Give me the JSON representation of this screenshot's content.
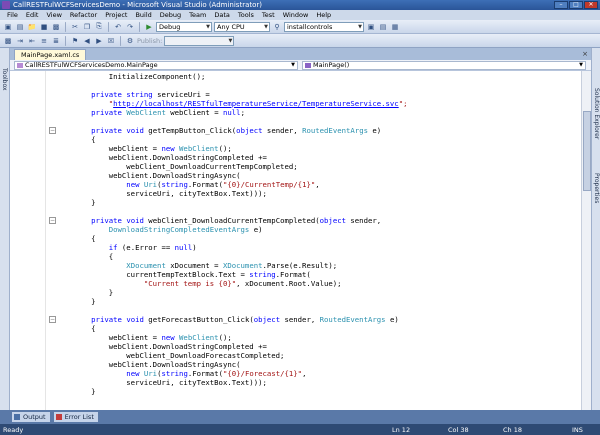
{
  "window": {
    "title": "CallRESTFulWCFServicesDemo - Microsoft Visual Studio (Administrator)"
  },
  "menu": [
    "File",
    "Edit",
    "View",
    "Refactor",
    "Project",
    "Build",
    "Debug",
    "Team",
    "Data",
    "Tools",
    "Test",
    "Window",
    "Help"
  ],
  "toolbar": {
    "config": "Debug",
    "platform": "Any CPU",
    "find_value": "installcontrols",
    "publish_label": "Publish:"
  },
  "tabs": {
    "active_label": "MainPage.xaml.cs"
  },
  "navbar": {
    "class_combo": "CallRESTFulWCFServicesDemo.MainPage",
    "member_combo": "MainPage()"
  },
  "side": {
    "left_label": "Toolbox",
    "right_labels": [
      "Solution Explorer",
      "Properties"
    ]
  },
  "code_lines": [
    [
      {
        "t": "            InitializeComponent();"
      }
    ],
    [],
    [
      {
        "t": "        "
      },
      {
        "t": "private",
        "c": "kw"
      },
      {
        "t": " "
      },
      {
        "t": "string",
        "c": "kw"
      },
      {
        "t": " serviceUri ="
      }
    ],
    [
      {
        "t": "            "
      },
      {
        "t": "\"",
        "c": "st"
      },
      {
        "t": "http://localhost/RESTfulTemperatureService/TemperatureService.svc",
        "c": "ul"
      },
      {
        "t": "\";",
        "c": "st"
      }
    ],
    [
      {
        "t": "        "
      },
      {
        "t": "private",
        "c": "kw"
      },
      {
        "t": " "
      },
      {
        "t": "WebClient",
        "c": "ty"
      },
      {
        "t": " webClient = "
      },
      {
        "t": "null",
        "c": "kw"
      },
      {
        "t": ";"
      }
    ],
    [],
    [
      {
        "t": "        "
      },
      {
        "t": "private",
        "c": "kw"
      },
      {
        "t": " "
      },
      {
        "t": "void",
        "c": "kw"
      },
      {
        "t": " getTempButton_Click("
      },
      {
        "t": "object",
        "c": "kw"
      },
      {
        "t": " sender, "
      },
      {
        "t": "RoutedEventArgs",
        "c": "ty"
      },
      {
        "t": " e)"
      }
    ],
    [
      {
        "t": "        {"
      }
    ],
    [
      {
        "t": "            webClient = "
      },
      {
        "t": "new",
        "c": "kw"
      },
      {
        "t": " "
      },
      {
        "t": "WebClient",
        "c": "ty"
      },
      {
        "t": "();"
      }
    ],
    [
      {
        "t": "            webClient.DownloadStringCompleted +="
      }
    ],
    [
      {
        "t": "                webClient_DownloadCurrentTempCompleted;"
      }
    ],
    [
      {
        "t": "            webClient.DownloadStringAsync("
      }
    ],
    [
      {
        "t": "                "
      },
      {
        "t": "new",
        "c": "kw"
      },
      {
        "t": " "
      },
      {
        "t": "Uri",
        "c": "ty"
      },
      {
        "t": "("
      },
      {
        "t": "string",
        "c": "kw"
      },
      {
        "t": ".Format("
      },
      {
        "t": "\"{0}/CurrentTemp/{1}\"",
        "c": "st"
      },
      {
        "t": ","
      }
    ],
    [
      {
        "t": "                serviceUri, cityTextBox.Text)));"
      }
    ],
    [
      {
        "t": "        }"
      }
    ],
    [],
    [
      {
        "t": "        "
      },
      {
        "t": "private",
        "c": "kw"
      },
      {
        "t": " "
      },
      {
        "t": "void",
        "c": "kw"
      },
      {
        "t": " webClient_DownloadCurrentTempCompleted("
      },
      {
        "t": "object",
        "c": "kw"
      },
      {
        "t": " sender,"
      }
    ],
    [
      {
        "t": "            "
      },
      {
        "t": "DownloadStringCompletedEventArgs",
        "c": "ty"
      },
      {
        "t": " e)"
      }
    ],
    [
      {
        "t": "        {"
      }
    ],
    [
      {
        "t": "            "
      },
      {
        "t": "if",
        "c": "kw"
      },
      {
        "t": " (e.Error == "
      },
      {
        "t": "null",
        "c": "kw"
      },
      {
        "t": ")"
      }
    ],
    [
      {
        "t": "            {"
      }
    ],
    [
      {
        "t": "                "
      },
      {
        "t": "XDocument",
        "c": "ty"
      },
      {
        "t": " xDocument = "
      },
      {
        "t": "XDocument",
        "c": "ty"
      },
      {
        "t": ".Parse(e.Result);"
      }
    ],
    [
      {
        "t": "                currentTempTextBlock.Text = "
      },
      {
        "t": "string",
        "c": "kw"
      },
      {
        "t": ".Format("
      }
    ],
    [
      {
        "t": "                    "
      },
      {
        "t": "\"Current temp is {0}\"",
        "c": "st"
      },
      {
        "t": ", xDocument.Root.Value);"
      }
    ],
    [
      {
        "t": "            }"
      }
    ],
    [
      {
        "t": "        }"
      }
    ],
    [],
    [
      {
        "t": "        "
      },
      {
        "t": "private",
        "c": "kw"
      },
      {
        "t": " "
      },
      {
        "t": "void",
        "c": "kw"
      },
      {
        "t": " getForecastButton_Click("
      },
      {
        "t": "object",
        "c": "kw"
      },
      {
        "t": " sender, "
      },
      {
        "t": "RoutedEventArgs",
        "c": "ty"
      },
      {
        "t": " e)"
      }
    ],
    [
      {
        "t": "        {"
      }
    ],
    [
      {
        "t": "            webClient = "
      },
      {
        "t": "new",
        "c": "kw"
      },
      {
        "t": " "
      },
      {
        "t": "WebClient",
        "c": "ty"
      },
      {
        "t": "();"
      }
    ],
    [
      {
        "t": "            webClient.DownloadStringCompleted +="
      }
    ],
    [
      {
        "t": "                webClient_DownloadForecastCompleted;"
      }
    ],
    [
      {
        "t": "            webClient.DownloadStringAsync("
      }
    ],
    [
      {
        "t": "                "
      },
      {
        "t": "new",
        "c": "kw"
      },
      {
        "t": " "
      },
      {
        "t": "Uri",
        "c": "ty"
      },
      {
        "t": "("
      },
      {
        "t": "string",
        "c": "kw"
      },
      {
        "t": ".Format("
      },
      {
        "t": "\"{0}/Forecast/{1}\"",
        "c": "st"
      },
      {
        "t": ","
      }
    ],
    [
      {
        "t": "                serviceUri, cityTextBox.Text)));"
      }
    ],
    [
      {
        "t": "        }"
      }
    ]
  ],
  "bottom_tabs": [
    "Output",
    "Error List"
  ],
  "status": {
    "left": "Ready",
    "line": "Ln 12",
    "col": "Col 38",
    "ch": "Ch 18",
    "mode": "INS"
  }
}
